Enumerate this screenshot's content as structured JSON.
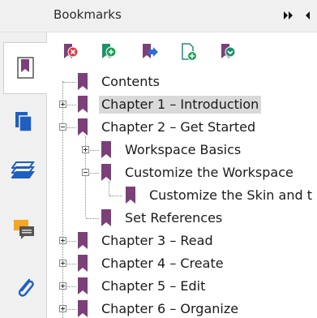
{
  "panel": {
    "title": "Bookmarks",
    "header_icons": [
      "double-chevron-right-icon",
      "chevron-left-icon"
    ]
  },
  "side_tabs": [
    {
      "name": "bookmarks",
      "icon": "bookmark-page-icon",
      "active": true
    },
    {
      "name": "pages",
      "icon": "pages-icon",
      "active": false
    },
    {
      "name": "layers",
      "icon": "layers-icon",
      "active": false
    },
    {
      "name": "comments",
      "icon": "comment-icon",
      "active": false
    },
    {
      "name": "attachments",
      "icon": "paperclip-icon",
      "active": false
    }
  ],
  "toolbar": [
    {
      "name": "delete-bookmark",
      "icon": "bookmark-delete-icon",
      "badge_color": "#e0383e"
    },
    {
      "name": "add-bookmark",
      "icon": "bookmark-add-icon",
      "badge_color": "#21a05a"
    },
    {
      "name": "go-to-bookmark",
      "icon": "bookmark-goto-icon",
      "badge_color": "#2d6fd6"
    },
    {
      "name": "add-page-bookmark",
      "icon": "page-add-icon",
      "badge_color": "#21a05a"
    },
    {
      "name": "expand-bookmark",
      "icon": "bookmark-expand-icon",
      "badge_color": "#1f8f6e"
    }
  ],
  "colors": {
    "bookmark": "#7d3f7a",
    "accent_blue": "#1e5fbf",
    "selected_bg": "#d9d9d9",
    "comment_orange": "#f5a623"
  },
  "tree": [
    {
      "label": "Contents",
      "level": 0,
      "expander": "none",
      "selected": false
    },
    {
      "label": "Chapter 1 – Introduction",
      "level": 0,
      "expander": "plus",
      "selected": true
    },
    {
      "label": "Chapter 2 – Get Started",
      "level": 0,
      "expander": "minus",
      "selected": false
    },
    {
      "label": "Workspace Basics",
      "level": 1,
      "expander": "plus",
      "selected": false
    },
    {
      "label": "Customize the Workspace",
      "level": 1,
      "expander": "minus",
      "selected": false
    },
    {
      "label": "Customize the Skin and t",
      "level": 2,
      "expander": "none",
      "selected": false
    },
    {
      "label": "Set References",
      "level": 1,
      "expander": "none",
      "selected": false
    },
    {
      "label": "Chapter 3 – Read",
      "level": 0,
      "expander": "plus",
      "selected": false
    },
    {
      "label": "Chapter 4 – Create",
      "level": 0,
      "expander": "plus",
      "selected": false
    },
    {
      "label": "Chapter 5 – Edit",
      "level": 0,
      "expander": "plus",
      "selected": false
    },
    {
      "label": "Chapter 6 – Organize",
      "level": 0,
      "expander": "plus",
      "selected": false
    }
  ]
}
